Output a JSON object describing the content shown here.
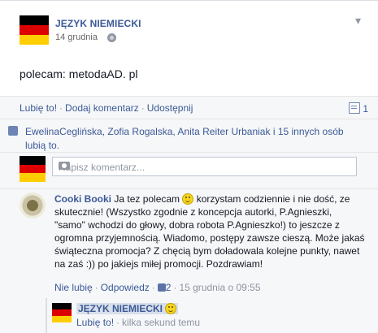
{
  "post": {
    "page_name": "JĘZYK NIEMIECKI",
    "date": "14 grudnia",
    "text": "polecam: metodaAD. pl",
    "chevron": "▾"
  },
  "actions": {
    "like": "Lubię to!",
    "comment": "Dodaj komentarz",
    "share": "Udostępnij",
    "separator": "·",
    "comment_count": "1"
  },
  "likes": {
    "text": "EwelinaCeglińska, Zofia Rogalska, Anita Reiter Urbaniak i 15 innych osób lubią to."
  },
  "compose": {
    "placeholder": "Napisz komentarz..."
  },
  "comment": {
    "author": "Cooki Booki",
    "text_1": " Ja tez polecam ",
    "text_2": " korzystam codziennie i nie dość, ze skutecznie! (Wszystko zgodnie z koncepcja autorki, P.Agnieszki, \"samo\" wchodzi do głowy, dobra robota P.Agnieszko!) to jeszcze z ogromna przyjemnością. Wiadomo, postępy zawsze cieszą. Może jakaś świąteczna promocja? Z chęcią bym doładowala kolejne punkty, nawet na zaś :)) po jakiejs miłej promocji. Pozdrawiam!",
    "unlike": "Nie lubię",
    "reply": "Odpowiedz",
    "like_count": "2",
    "timestamp": "15 grudnia o 09:55"
  },
  "reply": {
    "author": "JĘZYK NIEMIECKI",
    "like": "Lubię to!",
    "time": "kilka sekund temu"
  },
  "colors": {
    "link": "#3b5998",
    "flag_black": "#000000",
    "flag_red": "#dd0000",
    "flag_gold": "#ffce00"
  },
  "icons": [
    "flag-germany-icon",
    "globe-icon",
    "chevron-down-icon",
    "comment-icon",
    "thumbs-up-icon",
    "camera-icon",
    "smiley-icon"
  ]
}
